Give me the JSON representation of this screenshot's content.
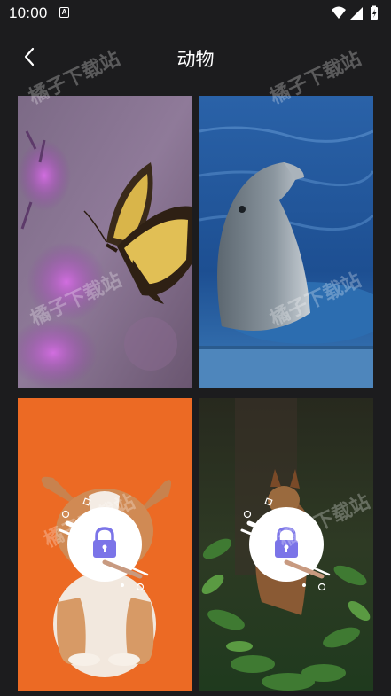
{
  "status_bar": {
    "time": "10:00",
    "notification_icon": "a-letter-icon",
    "icons": [
      "wifi-icon",
      "signal-icon",
      "battery-icon"
    ]
  },
  "app_bar": {
    "back_icon": "chevron-left-icon",
    "title": "动物"
  },
  "wallpapers": [
    {
      "subject": "butterfly",
      "locked": false
    },
    {
      "subject": "dolphin",
      "locked": false
    },
    {
      "subject": "corgi-puppy",
      "locked": true
    },
    {
      "subject": "squirrel",
      "locked": true
    }
  ],
  "watermark": "橘子下载站",
  "colors": {
    "background": "#1c1c1e",
    "lock_accent": "#7b74e8",
    "lock_circle": "#ffffff"
  }
}
